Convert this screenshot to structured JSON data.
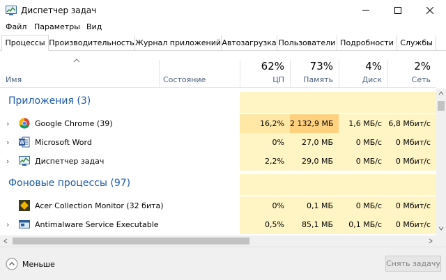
{
  "window": {
    "title": "Диспетчер задач"
  },
  "menu": [
    "Файл",
    "Параметры",
    "Вид"
  ],
  "tabs": [
    "Процессы",
    "Производительность",
    "Журнал приложений",
    "Автозагрузка",
    "Пользователи",
    "Подробности",
    "Службы"
  ],
  "columns": {
    "name": "Имя",
    "state": "Состояние",
    "cpu": {
      "pct": "62%",
      "label": "ЦП"
    },
    "memory": {
      "pct": "73%",
      "label": "Память"
    },
    "disk": {
      "pct": "4%",
      "label": "Диск"
    },
    "network": {
      "pct": "2%",
      "label": "Сеть"
    }
  },
  "groups": [
    {
      "title": "Приложения (3)"
    },
    {
      "title": "Фоновые процессы (97)"
    }
  ],
  "processes": [
    {
      "name": "Google Chrome (39)",
      "icon": "chrome-icon",
      "cpu": "16,2%",
      "memory": "2 132,9 МБ",
      "disk": "1,6 МБ/с",
      "network": "6,8 Мбит/с"
    },
    {
      "name": "Microsoft Word",
      "icon": "word-icon",
      "cpu": "0%",
      "memory": "27,0 МБ",
      "disk": "0 МБ/с",
      "network": "0 Мбит/с"
    },
    {
      "name": "Диспетчер задач",
      "icon": "task-manager-icon",
      "cpu": "2,2%",
      "memory": "29,0 МБ",
      "disk": "0 МБ/с",
      "network": "0 Мбит/с"
    },
    {
      "name": "Acer Collection Monitor (32 бита)",
      "icon": "acer-icon",
      "cpu": "0%",
      "memory": "0,1 МБ",
      "disk": "0 МБ/с",
      "network": "0 Мбит/с"
    },
    {
      "name": "Antimalware Service Executable",
      "icon": "antimalware-icon",
      "cpu": "0,5%",
      "memory": "85,1 МБ",
      "disk": "0,1 МБ/с",
      "network": "0 Мбит/с"
    }
  ],
  "footer": {
    "less": "Меньше",
    "end_task": "Снять задачу"
  },
  "colors": {
    "heat_light": "#fff4c4",
    "heat_medium": "#ffe8a6",
    "heat_strong": "#ffd17f",
    "group_title": "#1c5aa8",
    "header_label": "#4c607a"
  }
}
